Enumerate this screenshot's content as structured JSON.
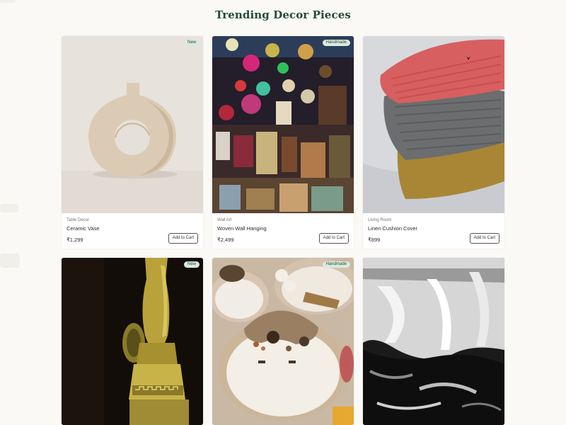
{
  "section": {
    "title": "Trending Decor Pieces"
  },
  "products": [
    {
      "badge": "New",
      "category": "Table Decor",
      "name": "Ceramic Vase",
      "price": "₹1,299",
      "cta": "Add to Cart",
      "image_icon": "ceramic-vase-photo"
    },
    {
      "badge": "Handmade",
      "category": "Wall Art",
      "name": "Woven Wall Hanging",
      "price": "₹2,499",
      "cta": "Add to Cart",
      "image_icon": "market-stall-photo"
    },
    {
      "badge": "",
      "category": "Living Room",
      "name": "Linen Cushion Cover",
      "price": "₹899",
      "cta": "Add to Cart",
      "image_icon": "knitted-cushions-photo"
    },
    {
      "badge": "New",
      "image_icon": "brass-lamp-photo"
    },
    {
      "badge": "Handmade",
      "image_icon": "candle-bowls-photo"
    },
    {
      "badge": "",
      "image_icon": "abstract-painting-photo"
    }
  ],
  "colors": {
    "page_background": "#faf9f6",
    "title": "#234a3c",
    "badge_background": "#d9eadc",
    "card_background": "#ffffff"
  }
}
